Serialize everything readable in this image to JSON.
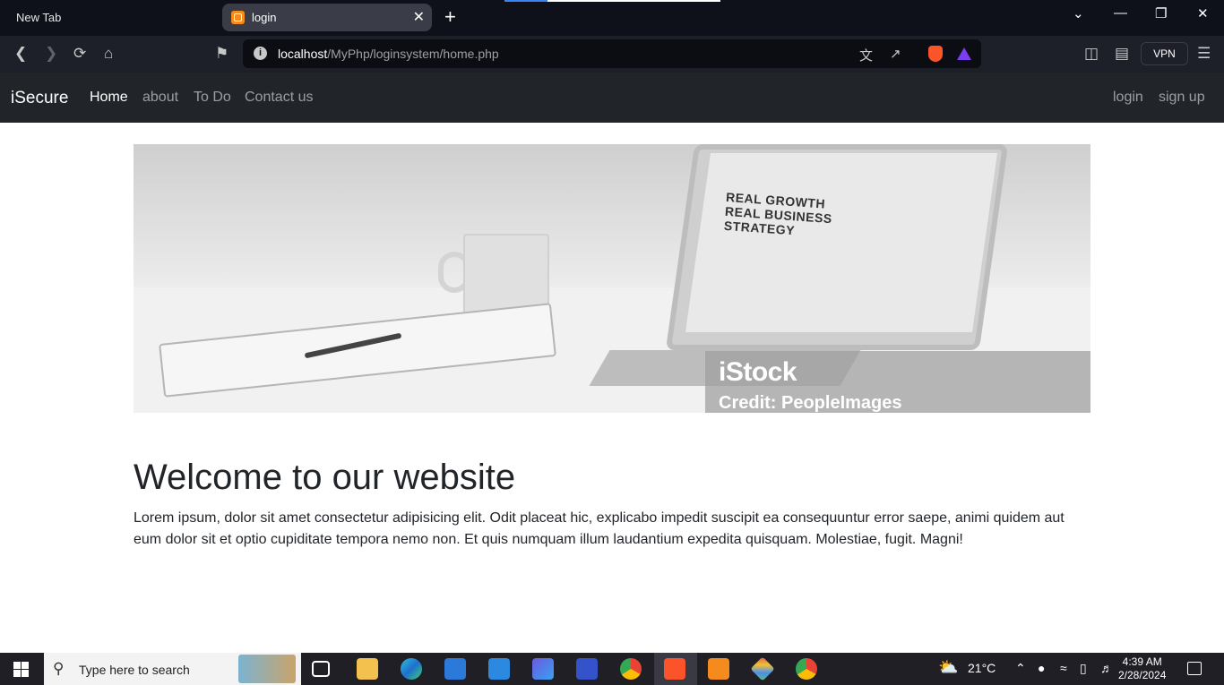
{
  "browser": {
    "tabs": [
      {
        "label": "New Tab"
      },
      {
        "label": "login"
      }
    ],
    "new_tab_symbol": "+",
    "window_controls": {
      "minimize": "—",
      "restore": "❐",
      "close": "✕",
      "tab_list": "⌄"
    },
    "url": {
      "host": "localhost",
      "path": "/MyPhp/loginsystem/home.php"
    },
    "vpn_label": "VPN"
  },
  "site": {
    "brand": "iSecure",
    "nav": [
      {
        "label": "Home"
      },
      {
        "label": "about"
      },
      {
        "label": "To Do"
      },
      {
        "label": "Contact us"
      }
    ],
    "auth": {
      "login": "login",
      "signup": "sign up"
    }
  },
  "hero": {
    "screen_text": "REAL GROWTH\nREAL BUSINESS\nSTRATEGY",
    "watermark": "iStock",
    "credit": "Credit: PeopleImages"
  },
  "content": {
    "heading": "Welcome to our website",
    "paragraph": "Lorem ipsum, dolor sit amet consectetur adipisicing elit. Odit placeat hic, explicabo impedit suscipit ea consequuntur error saepe, animi quidem aut eum dolor sit et optio cupiditate tempora nemo non. Et quis numquam illum laudantium expedita quisquam. Molestiae, fugit. Magni!"
  },
  "taskbar": {
    "search_placeholder": "Type here to search",
    "weather": "21°C",
    "time": "4:39 AM",
    "date": "2/28/2024"
  }
}
